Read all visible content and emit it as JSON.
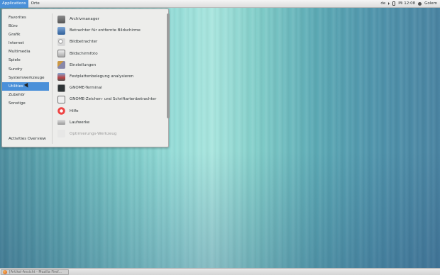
{
  "topbar": {
    "applications_label": "Applications",
    "places_label": "Orte",
    "keyboard_layout": "de",
    "clock": "Mi 12:08",
    "user_name": "Golem"
  },
  "menu": {
    "categories": [
      {
        "label": "Favorites"
      },
      {
        "label": "Büro"
      },
      {
        "label": "Grafik"
      },
      {
        "label": "Internet"
      },
      {
        "label": "Multimedia"
      },
      {
        "label": "Spiele"
      },
      {
        "label": "Sundry"
      },
      {
        "label": "Systemwerkzeuge"
      },
      {
        "label": "Utilities"
      },
      {
        "label": "Zubehör"
      },
      {
        "label": "Sonstige"
      }
    ],
    "selected_category": "Utilities",
    "activities_overview": "Activities Overview",
    "apps": [
      {
        "label": "Archivmanager",
        "icon": "archive-manager-icon"
      },
      {
        "label": "Betrachter für entfernte Bildschirme",
        "icon": "remote-desktop-viewer-icon"
      },
      {
        "label": "Bildbetrachter",
        "icon": "image-viewer-icon"
      },
      {
        "label": "Bildschirmfoto",
        "icon": "screenshot-icon"
      },
      {
        "label": "Einstellungen",
        "icon": "settings-icon"
      },
      {
        "label": "Festplattenbelegung analysieren",
        "icon": "disk-usage-icon"
      },
      {
        "label": "GNOME-Terminal",
        "icon": "terminal-icon"
      },
      {
        "label": "GNOME-Zeichen- und Schriftartenbetrachter",
        "icon": "font-viewer-icon"
      },
      {
        "label": "Hilfe",
        "icon": "help-icon"
      },
      {
        "label": "Laufwerke",
        "icon": "disks-icon"
      },
      {
        "label": "Optimierungs-Werkzeug",
        "icon": "tweak-tool-icon"
      }
    ]
  },
  "taskbar": {
    "window_label": "[Artikel-Ansicht - Mozilla Firef..."
  },
  "colors": {
    "accent": "#4a90d9",
    "menu_background": "#ededeb"
  }
}
